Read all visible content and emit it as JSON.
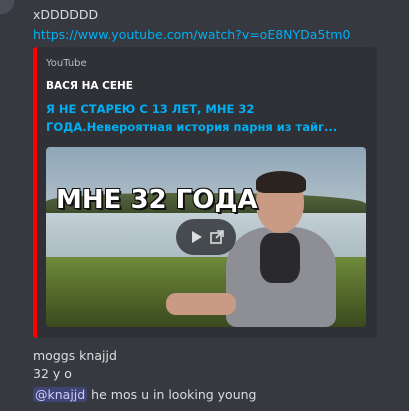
{
  "messages": {
    "first": "xDDDDDD",
    "link": "https://www.youtube.com/watch?v=oE8NYDa5tm0"
  },
  "embed": {
    "provider": "YouTube",
    "author": "ВАСЯ НА СЕНЕ",
    "title": "Я НЕ СТАРЕЮ С 13 ЛЕТ, МНЕ 32 ГОДА.Невероятная история парня из тайг...",
    "thumbnail_overlay": "МНЕ 32 ГОДА",
    "accent_color": "#ff0000"
  },
  "reply": {
    "author": "moggs knajjd",
    "line1": "32 y  o",
    "mention": "@knajjd",
    "line2_rest": " he mos u in looking young"
  },
  "icons": {
    "play": "play-icon",
    "external": "external-link-icon"
  }
}
